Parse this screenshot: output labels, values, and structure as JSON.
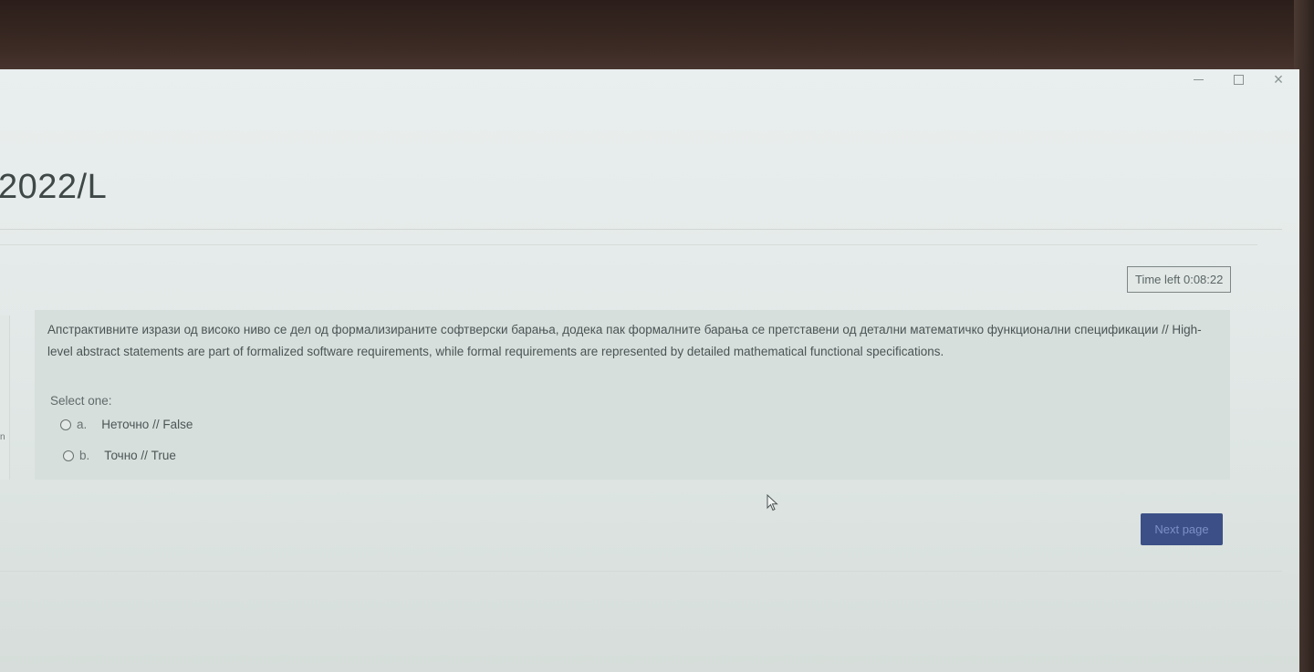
{
  "window": {
    "controls": {
      "minimize": "minimize-icon",
      "maximize": "maximize-icon",
      "close": "×"
    }
  },
  "course": {
    "title_fragment": "2022/L"
  },
  "timer": {
    "label": "Time left 0:08:22"
  },
  "side": {
    "letter": "n"
  },
  "question": {
    "text": "Апстрактивните изрази од високо ниво се дел од формализираните софтверски барања, додека пак формалните барања се претставени од детални математичко функционални спецификации // High-level abstract statements are part of formalized software requirements, while formal requirements are represented by detailed mathematical functional specifications.",
    "prompt": "Select one:",
    "options": [
      {
        "letter": "a.",
        "label": "Неточно // False",
        "selected": false
      },
      {
        "letter": "b.",
        "label": "Точно // True",
        "selected": false
      }
    ]
  },
  "navigation": {
    "next_label": "Next page"
  },
  "colors": {
    "primary_button": "#3c4f86",
    "background": "#e5ebea"
  }
}
